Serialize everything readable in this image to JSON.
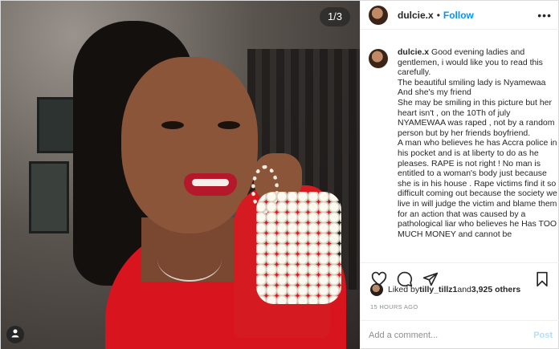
{
  "post": {
    "counter": "1/3",
    "header": {
      "username": "dulcie.x",
      "separator": "•",
      "follow_label": "Follow",
      "more": "•••"
    },
    "caption": {
      "username": "dulcie.x",
      "text": " Good evening ladies and gentlemen, i would like you to read this carefully.\nThe beautiful smiling lady is Nyamewaa And she's my friend\nShe may be smiling in this picture but her heart isn't , on the 10Th of july NYAMEWAA was raped , not by a random person but by her friends boyfriend.\nA man who believes he has Accra police in his pocket and is at liberty to do as he pleases. RAPE is not right ! No man is entitled to a woman's body just because she is in his house . Rape victims find it so difficult coming out because the society we live in will judge the victim and blame them for an action that was caused by a pathological liar who believes he Has TOO MUCH MONEY and cannot be"
    },
    "likes": {
      "prefix": "Liked by ",
      "user": "tilly_tillz1",
      "middle": " and ",
      "count": "3,925 others"
    },
    "timestamp": "15 HOURS AGO",
    "comment": {
      "placeholder": "Add a comment...",
      "post_label": "Post"
    },
    "icons": [
      "heart-icon",
      "comment-icon",
      "share-icon",
      "bookmark-icon",
      "tag-user-icon"
    ]
  }
}
